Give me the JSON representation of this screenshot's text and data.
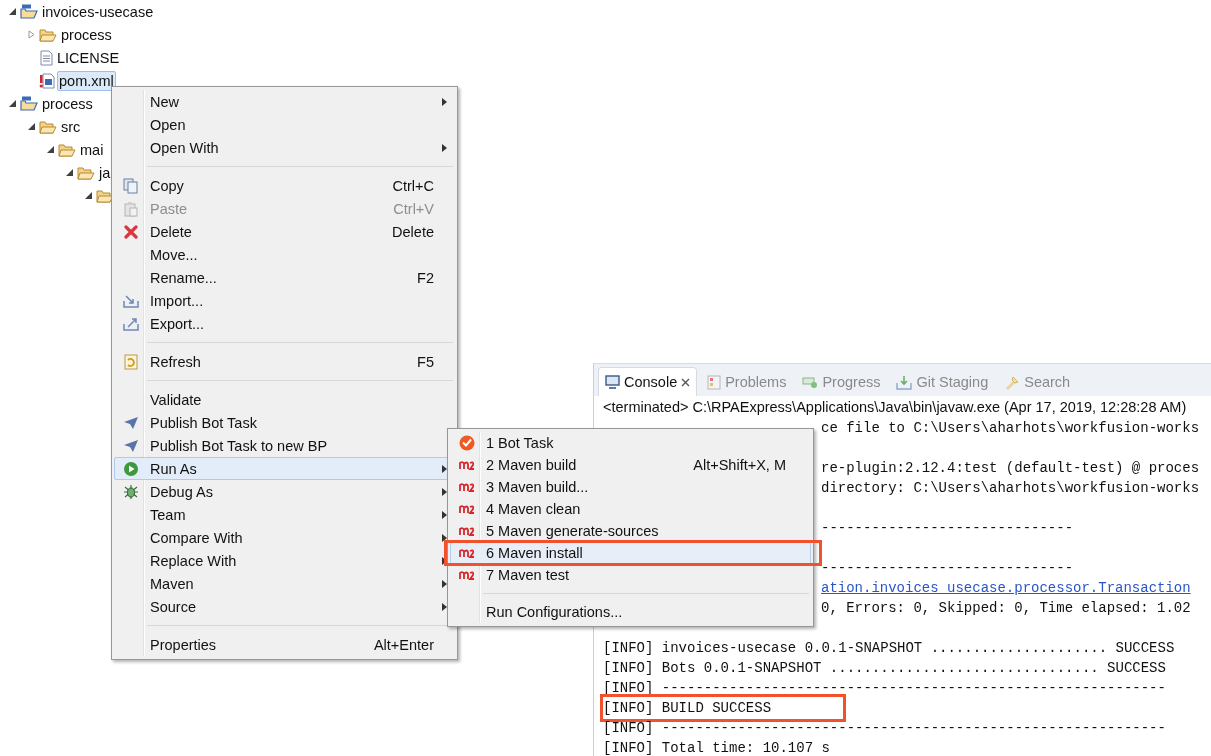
{
  "tree": [
    {
      "label": "invoices-usecase",
      "kind": "project",
      "expanded": true,
      "selected": false,
      "children": [
        {
          "label": "process",
          "kind": "folder",
          "expanded": false,
          "selected": false
        },
        {
          "label": "LICENSE",
          "kind": "file",
          "selected": false
        },
        {
          "label": "pom.xml",
          "kind": "pom",
          "selected": true
        }
      ]
    },
    {
      "label": "process",
      "kind": "project",
      "expanded": true,
      "selected": false,
      "children": [
        {
          "label": "src",
          "kind": "folder",
          "expanded": true,
          "selected": false,
          "children": [
            {
              "label": "mai",
              "kind": "folder",
              "expanded": true,
              "selected": false,
              "children": [
                {
                  "label": "ja",
                  "kind": "folder",
                  "expanded": true,
                  "selected": false,
                  "children": [
                    {
                      "kind": "folder",
                      "expanded": true
                    }
                  ]
                }
              ]
            }
          ]
        }
      ]
    }
  ],
  "context_menu": {
    "items": [
      {
        "kind": "item",
        "label": "New",
        "submenu": true,
        "disabled": false,
        "selected": false
      },
      {
        "kind": "item",
        "label": "Open",
        "submenu": false,
        "disabled": false,
        "selected": false
      },
      {
        "kind": "item",
        "label": "Open With",
        "submenu": true,
        "disabled": false,
        "selected": false
      },
      {
        "kind": "separator"
      },
      {
        "kind": "item",
        "label": "Copy",
        "shortcut": "Ctrl+C",
        "submenu": false,
        "disabled": false,
        "selected": false
      },
      {
        "kind": "item",
        "label": "Paste",
        "shortcut": "Ctrl+V",
        "submenu": false,
        "disabled": true,
        "selected": false
      },
      {
        "kind": "item",
        "label": "Delete",
        "shortcut": "Delete",
        "submenu": false,
        "disabled": false,
        "selected": false
      },
      {
        "kind": "item",
        "label": "Move...",
        "submenu": false,
        "disabled": false,
        "selected": false
      },
      {
        "kind": "item",
        "label": "Rename...",
        "shortcut": "F2",
        "submenu": false,
        "disabled": false,
        "selected": false
      },
      {
        "kind": "item",
        "label": "Import...",
        "submenu": false,
        "disabled": false,
        "selected": false
      },
      {
        "kind": "item",
        "label": "Export...",
        "submenu": false,
        "disabled": false,
        "selected": false
      },
      {
        "kind": "separator"
      },
      {
        "kind": "item",
        "label": "Refresh",
        "shortcut": "F5",
        "submenu": false,
        "disabled": false,
        "selected": false
      },
      {
        "kind": "separator"
      },
      {
        "kind": "item",
        "label": "Validate",
        "submenu": false,
        "disabled": false,
        "selected": false
      },
      {
        "kind": "item",
        "label": "Publish Bot Task",
        "submenu": false,
        "disabled": false,
        "selected": false
      },
      {
        "kind": "item",
        "label": "Publish Bot Task to new BP",
        "submenu": false,
        "disabled": false,
        "selected": false
      },
      {
        "kind": "item",
        "label": "Run As",
        "submenu": true,
        "disabled": false,
        "selected": true
      },
      {
        "kind": "item",
        "label": "Debug As",
        "submenu": true,
        "disabled": false,
        "selected": false
      },
      {
        "kind": "item",
        "label": "Team",
        "submenu": true,
        "disabled": false,
        "selected": false
      },
      {
        "kind": "item",
        "label": "Compare With",
        "submenu": true,
        "disabled": false,
        "selected": false
      },
      {
        "kind": "item",
        "label": "Replace With",
        "submenu": true,
        "disabled": false,
        "selected": false
      },
      {
        "kind": "item",
        "label": "Maven",
        "submenu": true,
        "disabled": false,
        "selected": false
      },
      {
        "kind": "item",
        "label": "Source",
        "submenu": true,
        "disabled": false,
        "selected": false
      },
      {
        "kind": "separator"
      },
      {
        "kind": "item",
        "label": "Properties",
        "shortcut": "Alt+Enter",
        "submenu": false,
        "disabled": false,
        "selected": false
      }
    ]
  },
  "run_as_menu": {
    "items": [
      {
        "kind": "bot",
        "label": "1 Bot Task",
        "selected": false,
        "highlighted": false
      },
      {
        "kind": "maven",
        "label": "2 Maven build",
        "shortcut": "Alt+Shift+X, M",
        "selected": false,
        "highlighted": false
      },
      {
        "kind": "maven",
        "label": "3 Maven build...",
        "selected": false,
        "highlighted": false
      },
      {
        "kind": "maven",
        "label": "4 Maven clean",
        "selected": false,
        "highlighted": false
      },
      {
        "kind": "maven",
        "label": "5 Maven generate-sources",
        "selected": false,
        "highlighted": false
      },
      {
        "kind": "maven",
        "label": "6 Maven install",
        "selected": true,
        "highlighted": true
      },
      {
        "kind": "maven",
        "label": "7 Maven test",
        "selected": false,
        "highlighted": false
      },
      {
        "kind": "separator"
      },
      {
        "kind": "plain",
        "label": "Run Configurations...",
        "selected": false,
        "highlighted": false
      }
    ]
  },
  "console": {
    "tabs": [
      {
        "label": "Console",
        "kind": "console",
        "selected": true
      },
      {
        "label": "Problems",
        "kind": "problems",
        "selected": false
      },
      {
        "label": "Progress",
        "kind": "progress",
        "selected": false
      },
      {
        "label": "Git Staging",
        "kind": "git",
        "selected": false
      },
      {
        "label": "Search",
        "kind": "search",
        "selected": false
      }
    ],
    "status": "<terminated> C:\\RPAExpress\\Applications\\Java\\bin\\javaw.exe (Apr 17, 2019, 12:28:28 AM)",
    "lines": [
      {
        "kind": "plain",
        "text": "ce file to C:\\Users\\aharhots\\workfusion-works",
        "covered": true,
        "highlighted": false
      },
      {
        "kind": "blank"
      },
      {
        "kind": "plain",
        "text": "re-plugin:2.12.4:test (default-test) @ proces",
        "covered": true,
        "highlighted": false
      },
      {
        "kind": "plain",
        "text": "directory: C:\\Users\\aharhots\\workfusion-works",
        "covered": true,
        "highlighted": false
      },
      {
        "kind": "blank"
      },
      {
        "kind": "plain",
        "text": "------------------------------",
        "covered": true,
        "highlighted": false
      },
      {
        "kind": "blank"
      },
      {
        "kind": "plain",
        "text": "------------------------------",
        "covered": true,
        "highlighted": false
      },
      {
        "kind": "link",
        "text": "ation.invoices usecase.processor.Transaction",
        "covered": true,
        "highlighted": false
      },
      {
        "kind": "plain",
        "text": "0, Errors: 0, Skipped: 0, Time elapsed: 1.02",
        "covered": true,
        "highlighted": false
      },
      {
        "kind": "blank"
      },
      {
        "kind": "plain",
        "text": "[INFO] invoices-usecase 0.0.1-SNAPSHOT ..................... SUCCESS",
        "covered": false,
        "highlighted": false
      },
      {
        "kind": "plain",
        "text": "[INFO] Bots 0.0.1-SNAPSHOT ................................ SUCCESS",
        "covered": false,
        "highlighted": false
      },
      {
        "kind": "plain",
        "text": "[INFO] ------------------------------------------------------------",
        "covered": false,
        "highlighted": false
      },
      {
        "kind": "plain",
        "text": "[INFO] BUILD SUCCESS",
        "covered": false,
        "highlighted": true
      },
      {
        "kind": "plain",
        "text": "[INFO] ------------------------------------------------------------",
        "covered": false,
        "highlighted": false
      },
      {
        "kind": "plain",
        "text": "[INFO] Total time: 10.107 s",
        "covered": false,
        "highlighted": false
      }
    ]
  }
}
